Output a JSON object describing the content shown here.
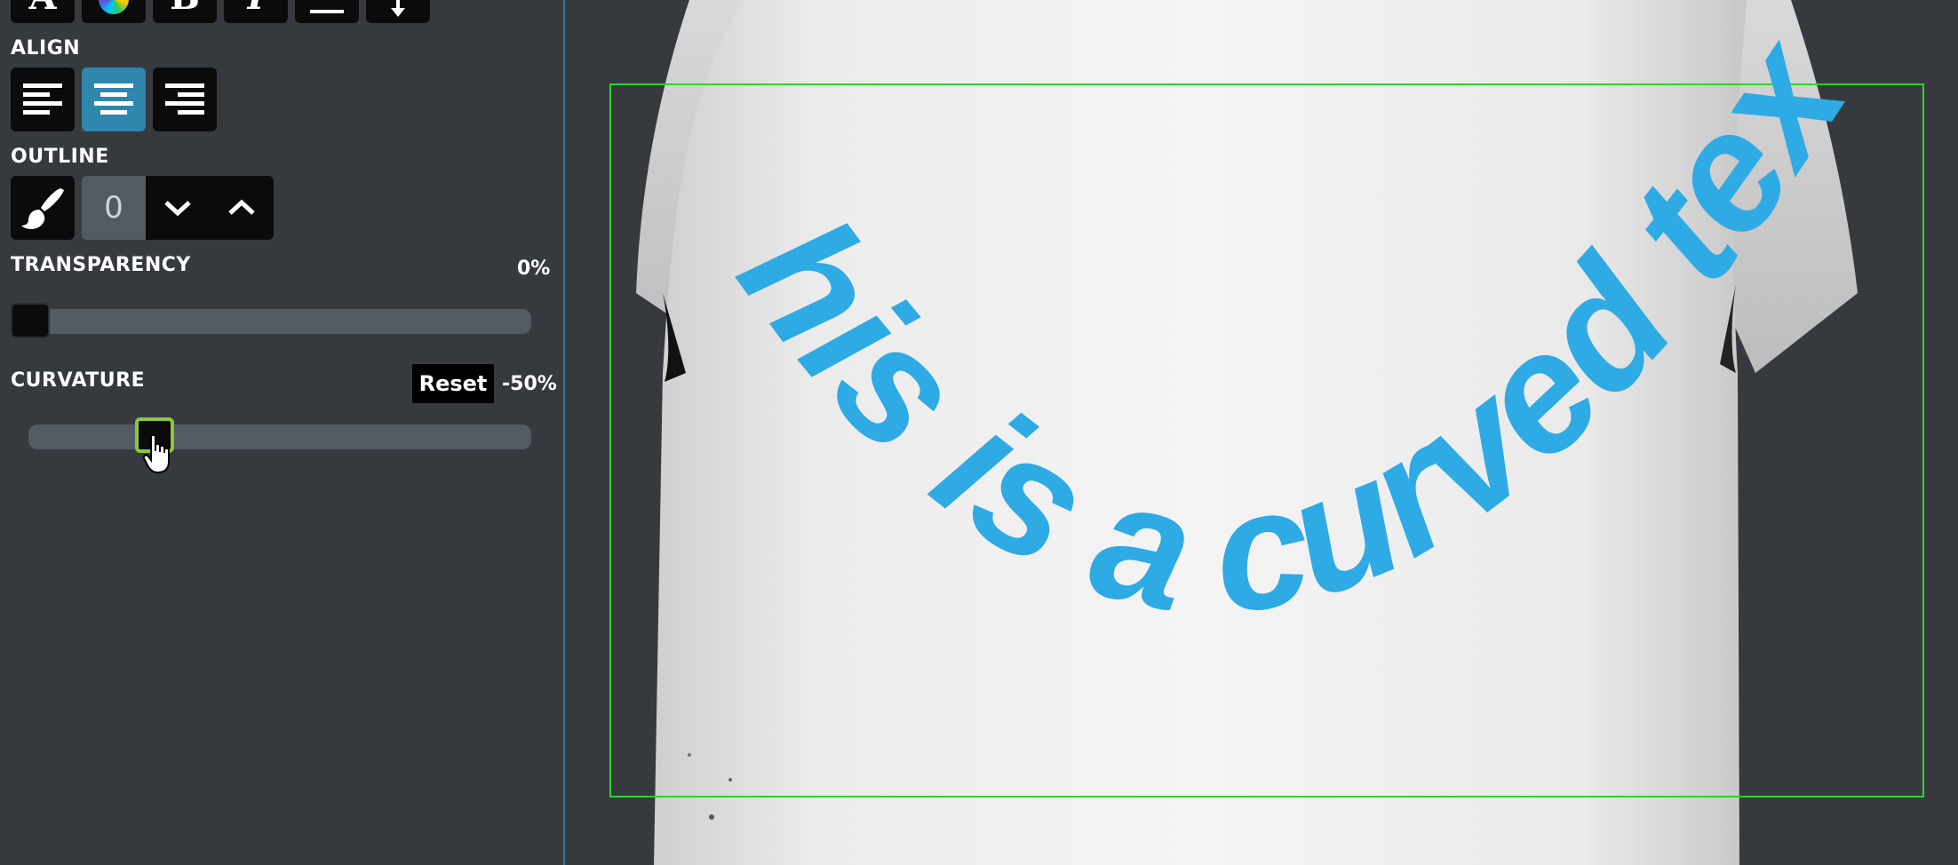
{
  "toolbar": {
    "top_icons": [
      "font-icon",
      "color-wheel-icon",
      "bold-icon",
      "italic-icon",
      "underline-icon",
      "arrow-down-icon"
    ]
  },
  "align": {
    "label": "ALIGN",
    "options": [
      "align-left",
      "align-center",
      "align-right"
    ],
    "selected": "align-center"
  },
  "outline": {
    "label": "OUTLINE",
    "value": "0"
  },
  "transparency": {
    "label": "TRANSPARENCY",
    "value_text": "0%",
    "value": 0
  },
  "curvature": {
    "label": "CURVATURE",
    "reset_label": "Reset",
    "value_text": "-50%",
    "value": -50
  },
  "canvas": {
    "curved_text": "This is a curved text",
    "text_color": "#2eaae4",
    "selection_color": "#2fd02f",
    "accent_color": "#2f87ad"
  }
}
